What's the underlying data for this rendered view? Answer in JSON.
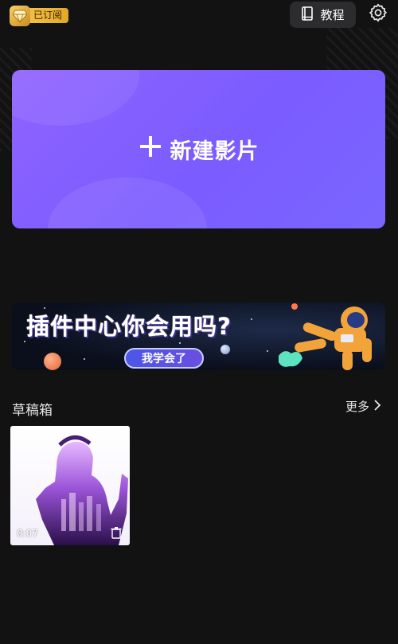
{
  "header": {
    "subscription_label": "已订阅",
    "tutorial_label": "教程"
  },
  "new_project": {
    "label": "新建影片"
  },
  "plugin_banner": {
    "headline": "插件中心你会用吗?",
    "cta_label": "我学会了"
  },
  "drafts": {
    "title": "草稿箱",
    "more_label": "更多",
    "items": [
      {
        "duration": "0:07"
      }
    ]
  },
  "icons": {
    "subscription": "diamond-icon",
    "tutorial": "book-icon",
    "settings": "gear-icon",
    "new_project": "plus-icon",
    "more": "chevron-right-icon",
    "delete": "trash-icon"
  },
  "colors": {
    "background": "#121212",
    "accent_purple": "#7b5cff",
    "subscription_gold": "#f3c34a"
  }
}
